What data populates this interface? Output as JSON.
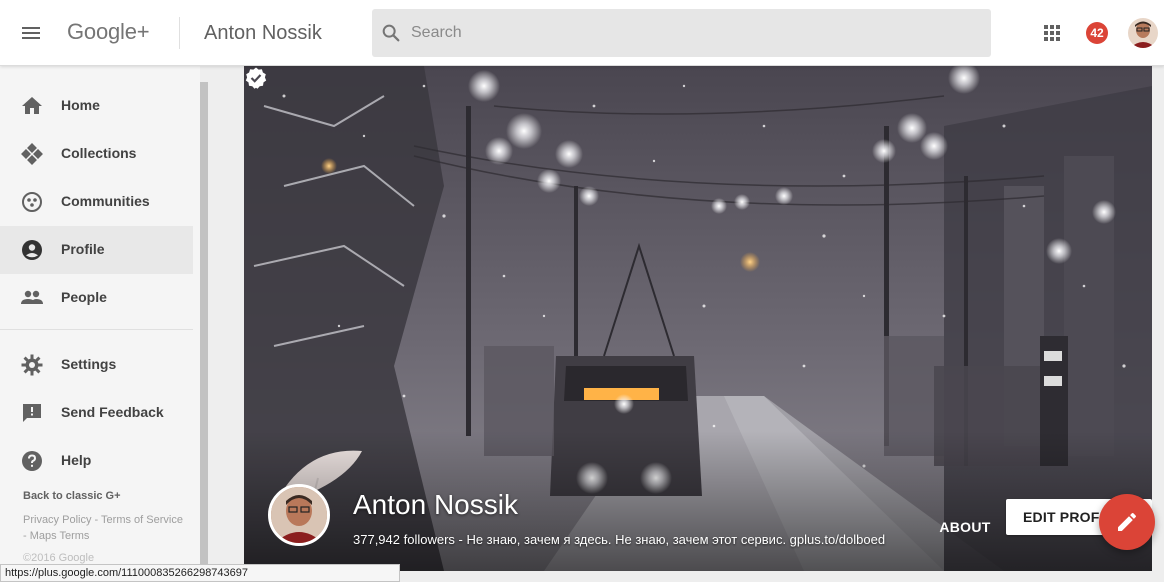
{
  "header": {
    "brand": "Google+",
    "page_title": "Anton Nossik",
    "search_placeholder": "Search",
    "notification_count": "42",
    "icons": [
      "menu-icon",
      "search-icon",
      "apps-grid-icon",
      "notifications-badge",
      "account-avatar"
    ]
  },
  "sidebar": {
    "items": [
      {
        "label": "Home",
        "icon": "home-icon"
      },
      {
        "label": "Collections",
        "icon": "collections-icon"
      },
      {
        "label": "Communities",
        "icon": "communities-icon"
      },
      {
        "label": "Profile",
        "icon": "profile-icon",
        "active": true
      },
      {
        "label": "People",
        "icon": "people-icon"
      },
      {
        "label": "Settings",
        "icon": "gear-icon"
      },
      {
        "label": "Send Feedback",
        "icon": "feedback-icon"
      },
      {
        "label": "Help",
        "icon": "help-icon"
      }
    ],
    "classic_link": "Back to classic G+",
    "footer": {
      "privacy": "Privacy Policy",
      "terms": "Terms of Service",
      "maps_terms": "Maps Terms",
      "separator": " - ",
      "copyright": "©2016 Google"
    }
  },
  "profile": {
    "name": "Anton Nossik",
    "verified": true,
    "tagline": "377,942 followers - Не знаю, зачем я здесь. Не знаю, зачем этот сервис. gplus.to/dolboed",
    "about_label": "ABOUT",
    "edit_label": "EDIT PROFILE"
  },
  "status_bar": {
    "url": "https://plus.google.com/111000835266298743697"
  },
  "colors": {
    "accent_red": "#db4437",
    "header_bg": "#ffffff",
    "sidebar_bg": "#f5f5f5",
    "active_item_bg": "#e8e8e8",
    "search_bg": "#e6e6e6"
  }
}
